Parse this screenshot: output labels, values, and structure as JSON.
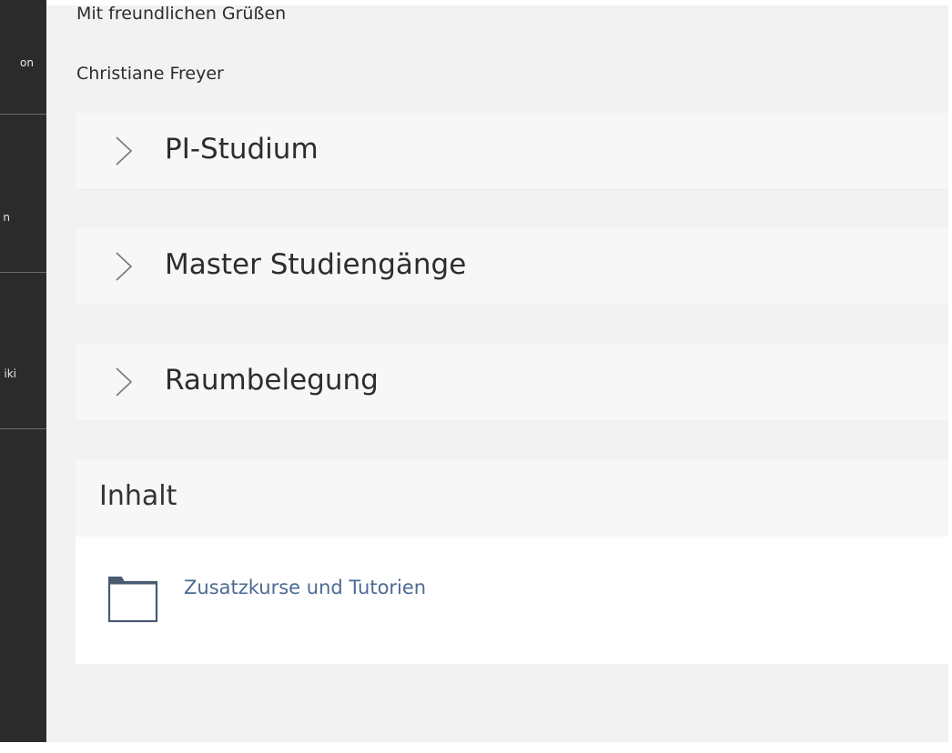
{
  "sidebar": {
    "items": [
      {
        "label": "on"
      },
      {
        "label": "n"
      },
      {
        "label": "iki"
      }
    ]
  },
  "closing": {
    "greeting": "Mit freundlichen Grüßen",
    "signature": "Christiane Freyer"
  },
  "sections": [
    {
      "title": "PI-Studium",
      "icon": "chevron-right-icon"
    },
    {
      "title": "Master Studiengänge",
      "icon": "chevron-right-icon"
    },
    {
      "title": "Raumbelegung",
      "icon": "chevron-right-icon"
    }
  ],
  "content": {
    "heading": "Inhalt",
    "items": [
      {
        "label": "Zusatzkurse und Tutorien",
        "icon": "folder-icon"
      }
    ]
  },
  "colors": {
    "sidebar": "#2b2b2b",
    "background": "#f2f2f2",
    "link": "#4c6a94",
    "accordion": "#f7f7f7"
  }
}
